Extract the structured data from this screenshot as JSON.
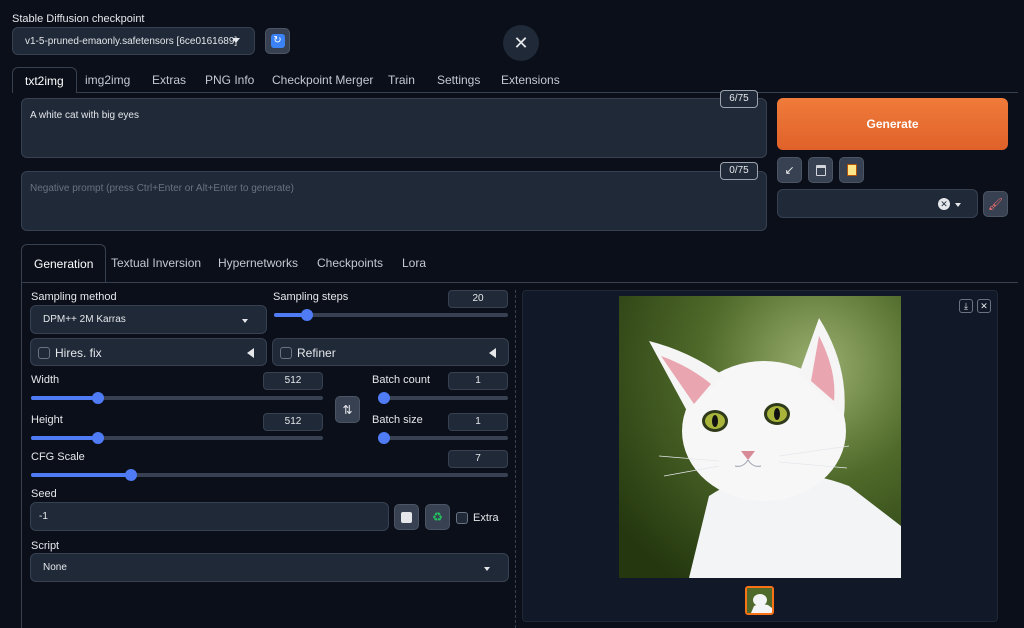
{
  "checkpoint": {
    "label": "Stable Diffusion checkpoint",
    "value": "v1-5-pruned-emaonly.safetensors [6ce0161689]"
  },
  "tabs": [
    "txt2img",
    "img2img",
    "Extras",
    "PNG Info",
    "Checkpoint Merger",
    "Train",
    "Settings",
    "Extensions"
  ],
  "prompt": {
    "value": "A white cat with big eyes",
    "token_count": "6/75"
  },
  "negative_prompt": {
    "placeholder": "Negative prompt (press Ctrl+Enter or Alt+Enter to generate)",
    "token_count": "0/75"
  },
  "generate_label": "Generate",
  "subtabs": [
    "Generation",
    "Textual Inversion",
    "Hypernetworks",
    "Checkpoints",
    "Lora"
  ],
  "generation": {
    "sampling_method_label": "Sampling method",
    "sampling_method_value": "DPM++ 2M Karras",
    "sampling_steps_label": "Sampling steps",
    "sampling_steps_value": "20",
    "sampling_steps_fraction": 0.14,
    "hires_label": "Hires. fix",
    "refiner_label": "Refiner",
    "width_label": "Width",
    "width_value": "512",
    "width_fraction": 0.23,
    "height_label": "Height",
    "height_value": "512",
    "height_fraction": 0.23,
    "batch_count_label": "Batch count",
    "batch_count_value": "1",
    "batch_count_fraction": 0.0,
    "batch_size_label": "Batch size",
    "batch_size_value": "1",
    "batch_size_fraction": 0.0,
    "cfg_label": "CFG Scale",
    "cfg_value": "7",
    "cfg_fraction": 0.21,
    "seed_label": "Seed",
    "seed_value": "-1",
    "extra_label": "Extra",
    "script_label": "Script",
    "script_value": "None"
  },
  "colors": {
    "accent": "#4f7bf5",
    "generate_start": "#f07b3a",
    "generate_end": "#e0622a",
    "background": "#0b0f19"
  }
}
